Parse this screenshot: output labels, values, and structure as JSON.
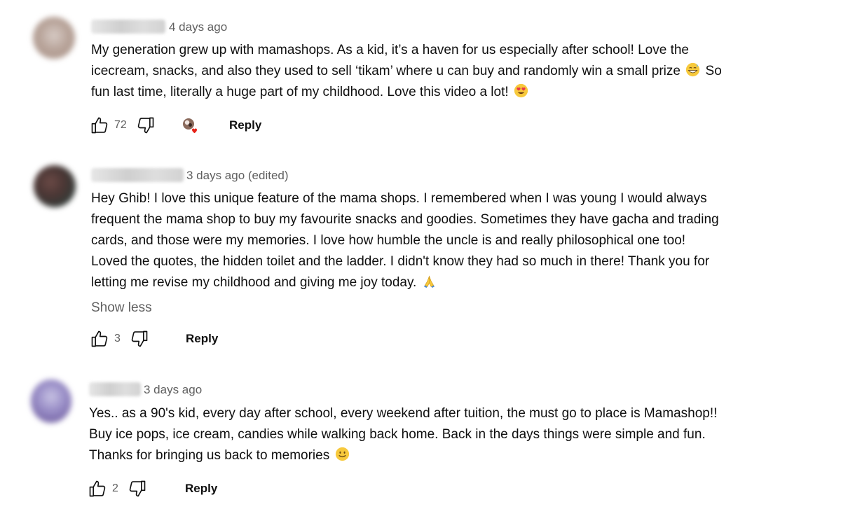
{
  "comments": [
    {
      "time": "4 days ago",
      "lines": [
        "My generation grew up with mamashops. As a kid, it’s a haven for us especially after school! Love the",
        "icecream, snacks, and also they used to sell ‘tikam’ where u can buy and randomly win a small prize",
        "fun last time, literally a huge part of my childhood. Love this video a lot!"
      ],
      "line2_tail": "So",
      "likes": "72",
      "reply_label": "Reply",
      "icons": {
        "emoji_1": "grinning-sweat-emoji",
        "emoji_2": "heart-eyes-emoji",
        "creator_heart": "creator-heart-badge"
      }
    },
    {
      "time": "3 days ago (edited)",
      "lines": [
        "Hey Ghib! I love this unique feature of the mama shops. I remembered when I was young I would always",
        "frequent the mama shop to buy my favourite snacks and goodies. Sometimes they have gacha and trading",
        "cards, and those were my memories. I love how humble the uncle is and really philosophical one too!",
        "Loved the quotes, the hidden toilet and the ladder. I didn't know they had so much in there! Thank you for",
        "letting me revise my childhood and giving me joy today."
      ],
      "show_less": "Show less",
      "likes": "3",
      "reply_label": "Reply",
      "icons": {
        "emoji_1": "folded-hands-emoji"
      }
    },
    {
      "time": "3 days ago",
      "lines": [
        "Yes.. as a 90's kid, every day after school, every weekend after tuition, the must go to place is Mamashop!!",
        "Buy ice pops, ice cream, candies while walking back home. Back in the days things were simple and fun.",
        "Thanks for bringing us back to memories"
      ],
      "likes": "2",
      "reply_label": "Reply",
      "icons": {
        "emoji_1": "slightly-smiling-emoji"
      }
    }
  ],
  "colors": {
    "text": "#0f0f0f",
    "secondary": "#606060",
    "heart": "#e62117"
  }
}
